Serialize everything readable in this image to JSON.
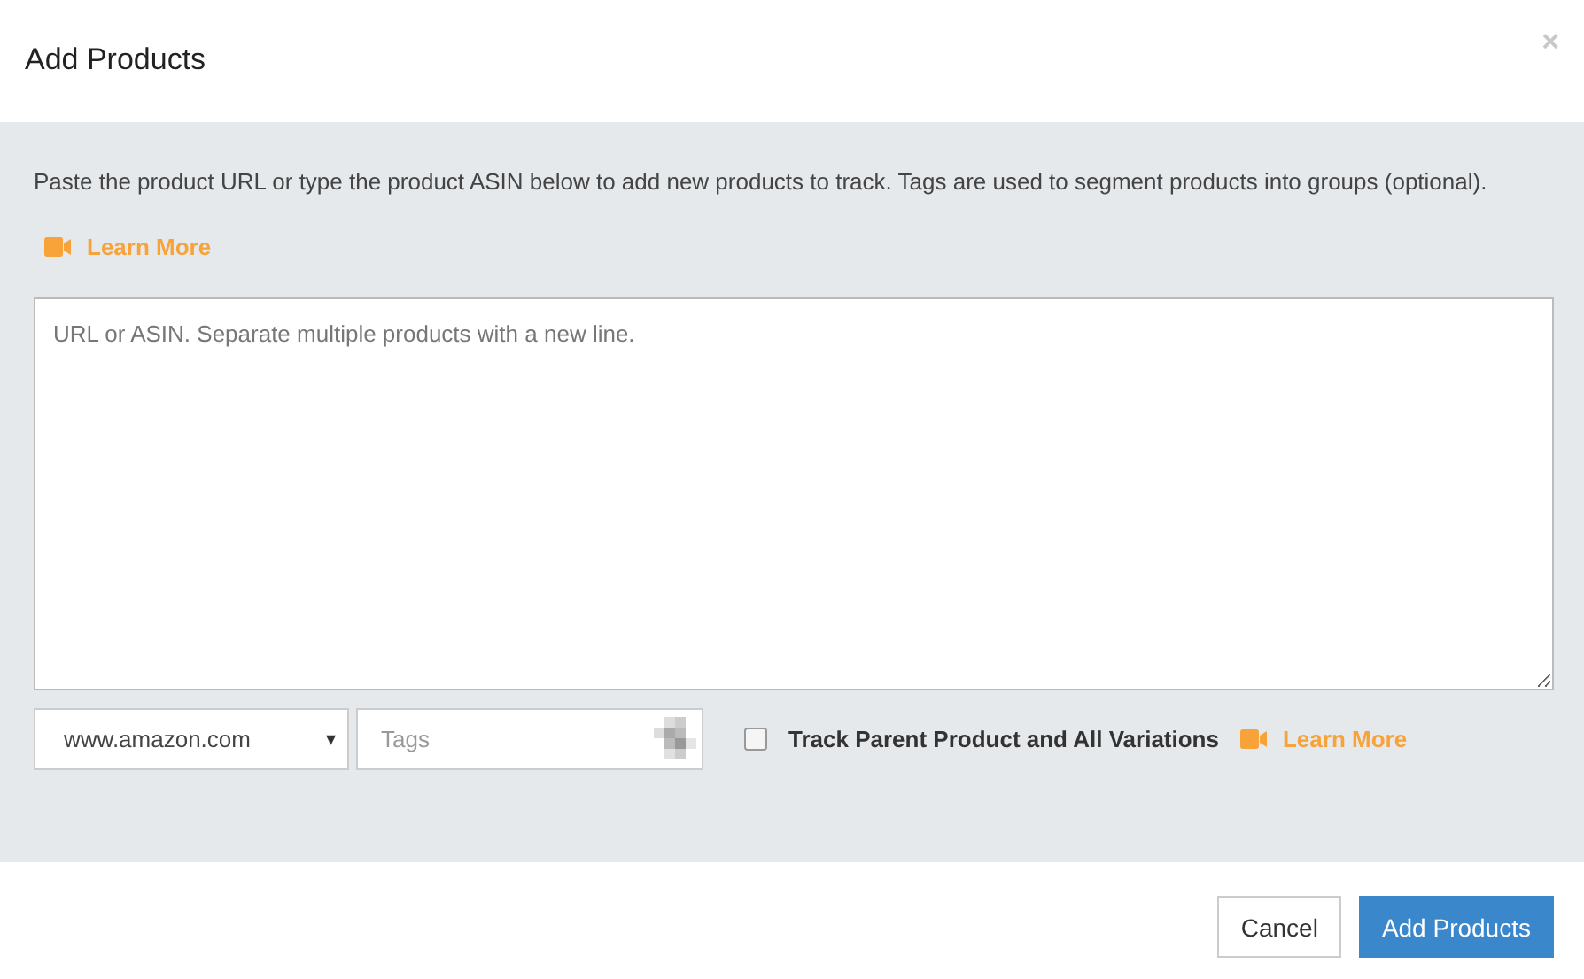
{
  "dialog": {
    "title": "Add Products",
    "close": "×"
  },
  "body": {
    "description": "Paste the product URL or type the product ASIN below to add new products to track. Tags are used to segment products into groups (optional).",
    "learn_more": "Learn More",
    "products_field": {
      "placeholder": "URL or ASIN. Separate multiple products with a new line."
    },
    "marketplace": {
      "value": "www.amazon.com",
      "caret": "▾"
    },
    "tags_field": {
      "placeholder": "Tags"
    },
    "track_variations": {
      "label": "Track Parent Product and All Variations",
      "checked": false
    },
    "learn_more_2": "Learn More"
  },
  "footer": {
    "buttons": [
      {
        "label": "Cancel",
        "kind": "default"
      },
      {
        "label": "Add Products",
        "kind": "primary"
      }
    ]
  }
}
